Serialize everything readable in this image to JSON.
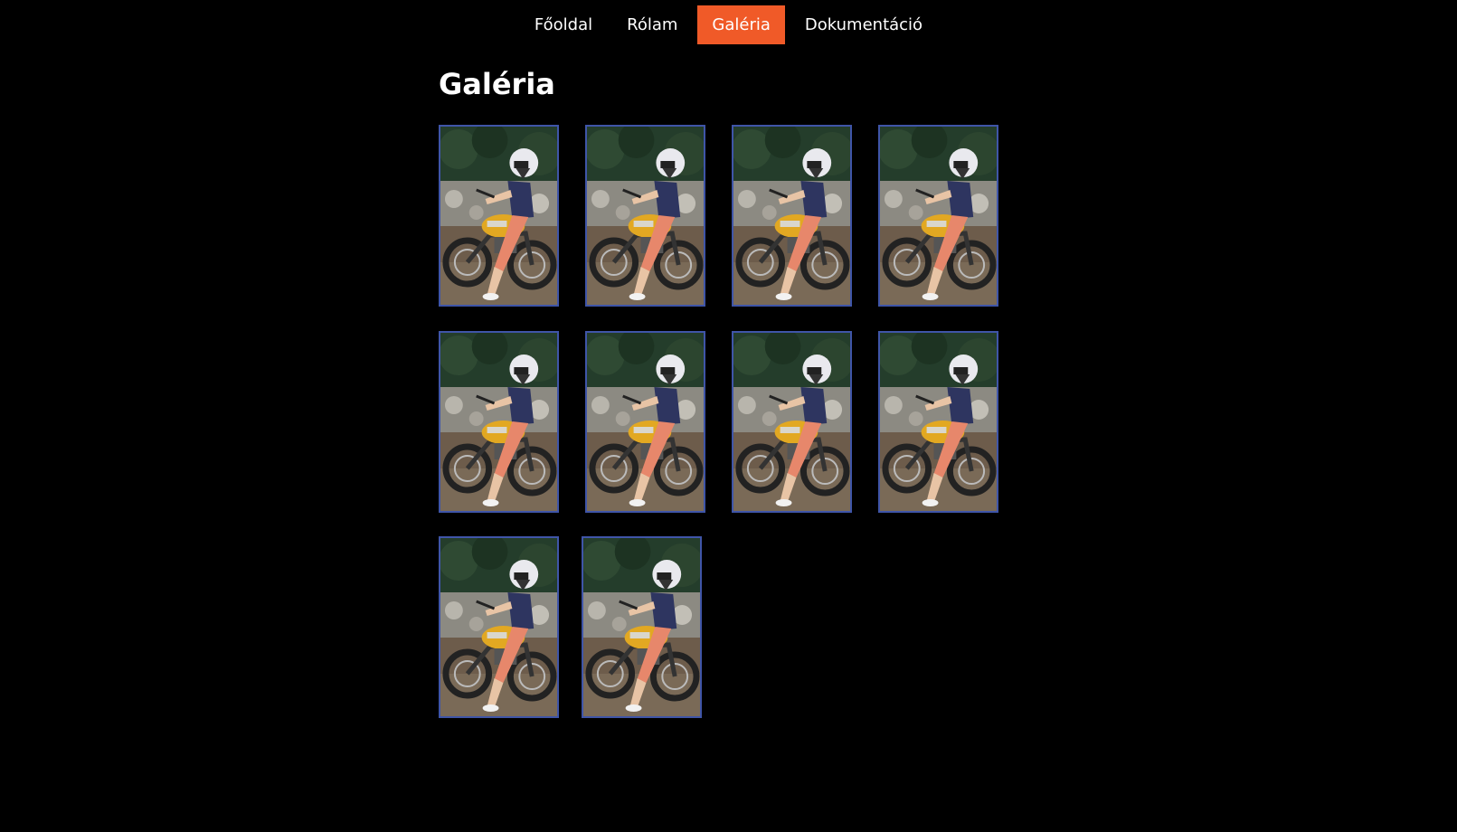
{
  "nav": {
    "items": [
      {
        "label": "Főoldal",
        "active": false
      },
      {
        "label": "Rólam",
        "active": false
      },
      {
        "label": "Galéria",
        "active": true
      },
      {
        "label": "Dokumentáció",
        "active": false
      }
    ]
  },
  "page": {
    "title": "Galéria"
  },
  "gallery": {
    "image_count": 10
  },
  "colors": {
    "background": "#000000",
    "active_nav": "#f05a28",
    "thumb_border": "#3f55a8"
  }
}
